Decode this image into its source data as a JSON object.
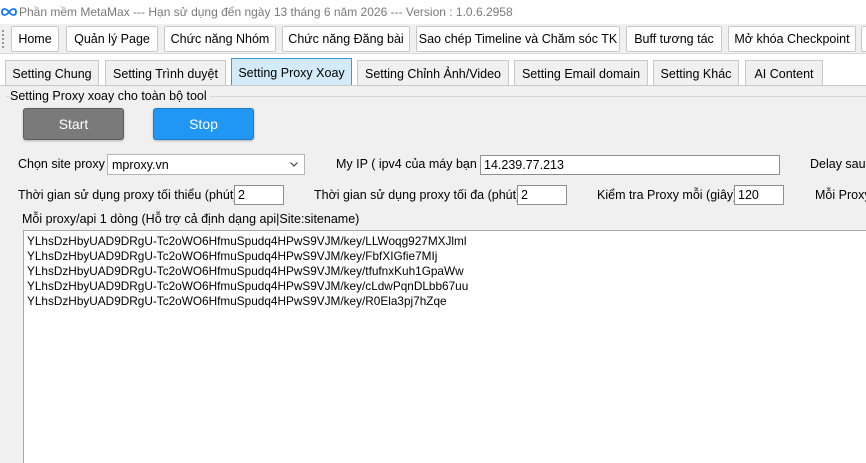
{
  "window": {
    "title": "Phần mềm MetaMax --- Hạn sử dụng đến ngày 13 tháng 6 năm 2026 --- Version : 1.0.6.2958",
    "app_icon": "meta-infinity-icon"
  },
  "menu": {
    "items": [
      {
        "label": "Home"
      },
      {
        "label": "Quản lý Page"
      },
      {
        "label": "Chức năng Nhóm"
      },
      {
        "label": "Chức năng Đăng bài"
      },
      {
        "label": "Sao chép Timeline và Chăm sóc TK"
      },
      {
        "label": "Buff tương tác"
      },
      {
        "label": "Mở khóa Checkpoint"
      }
    ]
  },
  "tabs": {
    "items": [
      {
        "label": "Setting Chung"
      },
      {
        "label": "Setting Trình duyệt"
      },
      {
        "label": "Setting Proxy Xoay"
      },
      {
        "label": "Setting Chỉnh Ảnh/Video"
      },
      {
        "label": "Setting Email domain"
      },
      {
        "label": "Setting Khác"
      },
      {
        "label": "AI Content"
      }
    ],
    "active_index": 2
  },
  "group": {
    "title": "Setting Proxy xoay cho toàn bộ tool"
  },
  "buttons": {
    "start": "Start",
    "stop": "Stop"
  },
  "form": {
    "site_label": "Chọn site proxy",
    "site_value": "mproxy.vn",
    "myip_label": "My IP ( ipv4 của máy bạn )",
    "myip_value": "14.239.77.213",
    "delay_label": "Delay sau l",
    "min_time_label": "Thời gian sử dụng proxy tối thiểu (phút)",
    "min_time_value": "2",
    "max_time_label": "Thời gian sử dụng proxy tối đa (phút)",
    "max_time_value": "2",
    "check_label": "Kiểm tra Proxy mỗi (giây)",
    "check_value": "120",
    "each_label": "Mỗi Proxy",
    "list_label": "Mỗi proxy/api 1 dòng (Hỗ trợ cả định dạng api|Site:sitename)"
  },
  "proxy_list": [
    "YLhsDzHbyUAD9DRgU-Tc2oWO6HfmuSpudq4HPwS9VJM/key/LLWoqg927MXJlml",
    "YLhsDzHbyUAD9DRgU-Tc2oWO6HfmuSpudq4HPwS9VJM/key/FbfXIGfie7MIj",
    "YLhsDzHbyUAD9DRgU-Tc2oWO6HfmuSpudq4HPwS9VJM/key/tfufnxKuh1GpaWw",
    "YLhsDzHbyUAD9DRgU-Tc2oWO6HfmuSpudq4HPwS9VJM/key/cLdwPqnDLbb67uu",
    "YLhsDzHbyUAD9DRgU-Tc2oWO6HfmuSpudq4HPwS9VJM/key/R0Ela3pj7hZqe"
  ],
  "colors": {
    "active_tab": "#d3ebf8",
    "start_button": "#7a7a7a",
    "stop_button": "#2196f3"
  }
}
